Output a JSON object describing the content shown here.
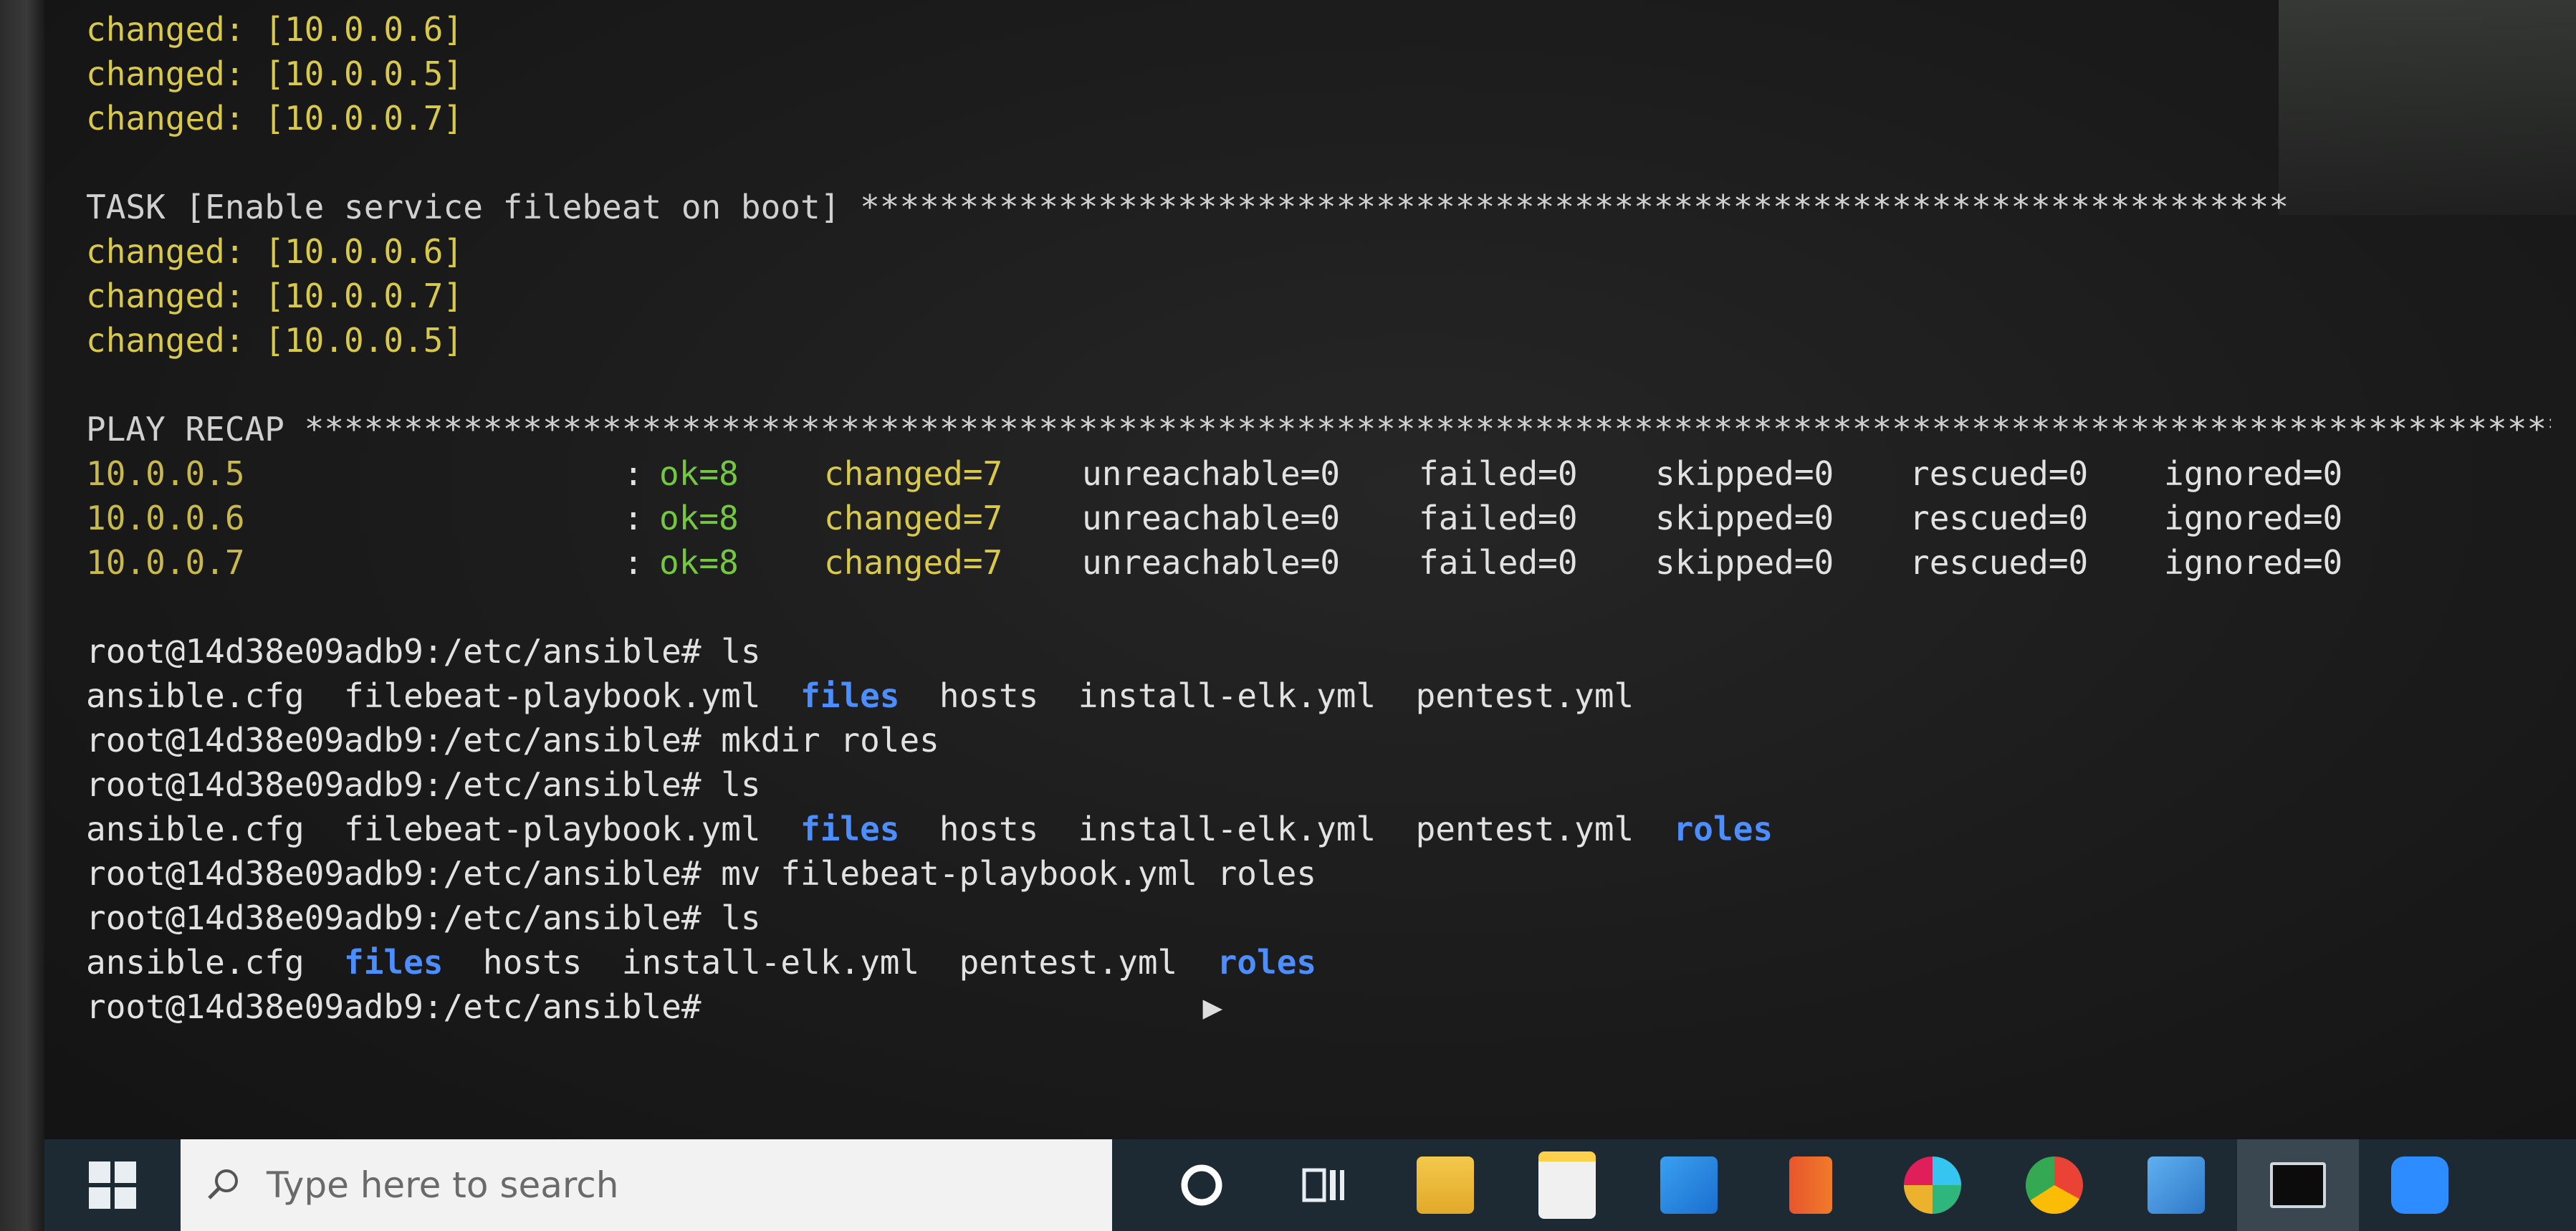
{
  "terminal": {
    "lines_top": [
      {
        "text": "changed: [10.0.0.6]"
      },
      {
        "text": "changed: [10.0.0.5]"
      },
      {
        "text": "changed: [10.0.0.7]"
      }
    ],
    "task_header": "TASK [Enable service filebeat on boot] ************************************************************************",
    "task_lines": [
      {
        "text": "changed: [10.0.0.6]"
      },
      {
        "text": "changed: [10.0.0.7]"
      },
      {
        "text": "changed: [10.0.0.5]"
      }
    ],
    "recap_header": "PLAY RECAP *************************************************************************************************************************",
    "recap_rows": [
      {
        "host": "10.0.0.5",
        "sep": ":",
        "ok": "ok=8",
        "changed": "changed=7",
        "unreachable": "unreachable=0",
        "failed": "failed=0",
        "skipped": "skipped=0",
        "rescued": "rescued=0",
        "ignored": "ignored=0"
      },
      {
        "host": "10.0.0.6",
        "sep": ":",
        "ok": "ok=8",
        "changed": "changed=7",
        "unreachable": "unreachable=0",
        "failed": "failed=0",
        "skipped": "skipped=0",
        "rescued": "rescued=0",
        "ignored": "ignored=0"
      },
      {
        "host": "10.0.0.7",
        "sep": ":",
        "ok": "ok=8",
        "changed": "changed=7",
        "unreachable": "unreachable=0",
        "failed": "failed=0",
        "skipped": "skipped=0",
        "rescued": "rescued=0",
        "ignored": "ignored=0"
      }
    ],
    "prompt": "root@14d38e09adb9:/etc/ansible#",
    "cmd1": " ls",
    "ls1": [
      "ansible.cfg",
      "filebeat-playbook.yml",
      "files",
      "hosts",
      "install-elk.yml",
      "pentest.yml"
    ],
    "cmd2": " mkdir roles",
    "cmd3": " ls",
    "ls2": [
      "ansible.cfg",
      "filebeat-playbook.yml",
      "files",
      "hosts",
      "install-elk.yml",
      "pentest.yml",
      "roles"
    ],
    "cmd4": " mv filebeat-playbook.yml roles",
    "cmd5": " ls",
    "ls3": [
      "ansible.cfg",
      "files",
      "hosts",
      "install-elk.yml",
      "pentest.yml",
      "roles"
    ]
  },
  "taskbar": {
    "search_placeholder": "Type here to search",
    "apps": [
      "cortana-icon",
      "task-view-icon",
      "file-explorer-icon",
      "store-icon",
      "mail-icon",
      "office-icon",
      "slack-icon",
      "chrome-icon",
      "photos-icon",
      "terminal-icon",
      "zoom-icon"
    ]
  },
  "colors": {
    "changed_yellow": "#d8c94a",
    "ok_green": "#74c840",
    "dir_blue": "#4c8dff",
    "taskbar_bg": "#1e2a33"
  }
}
